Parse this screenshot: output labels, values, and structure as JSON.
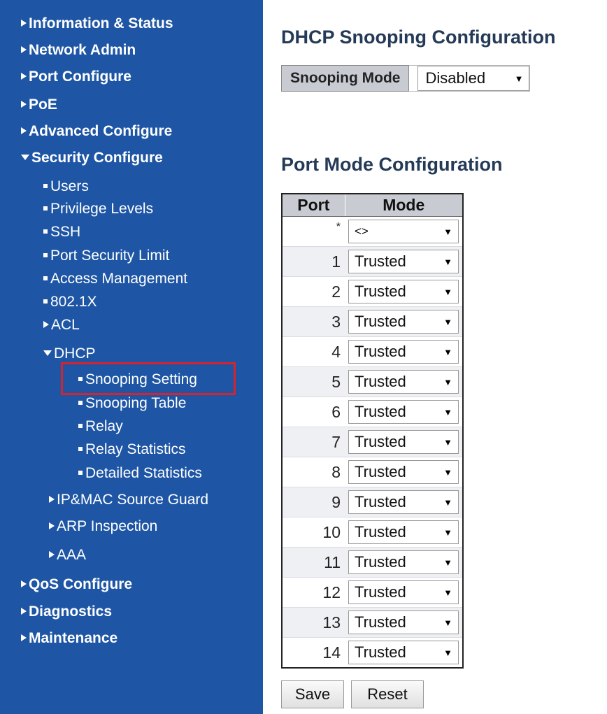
{
  "sidebar": {
    "items": [
      {
        "label": "Information & Status"
      },
      {
        "label": "Network Admin"
      },
      {
        "label": "Port Configure"
      },
      {
        "label": "PoE"
      },
      {
        "label": "Advanced Configure"
      },
      {
        "label": "Security Configure"
      },
      {
        "label": "Users"
      },
      {
        "label": "Privilege Levels"
      },
      {
        "label": "SSH"
      },
      {
        "label": "Port Security Limit"
      },
      {
        "label": "Access Management"
      },
      {
        "label": "802.1X"
      },
      {
        "label": "ACL"
      },
      {
        "label": "DHCP"
      },
      {
        "label": "Snooping Setting"
      },
      {
        "label": "Snooping Table"
      },
      {
        "label": "Relay"
      },
      {
        "label": "Relay Statistics"
      },
      {
        "label": "Detailed Statistics"
      },
      {
        "label": "IP&MAC Source Guard"
      },
      {
        "label": "ARP Inspection"
      },
      {
        "label": "AAA"
      },
      {
        "label": "QoS Configure"
      },
      {
        "label": "Diagnostics"
      },
      {
        "label": "Maintenance"
      }
    ]
  },
  "main": {
    "title": "DHCP Snooping Configuration",
    "snooping_mode_label": "Snooping Mode",
    "snooping_mode_value": "Disabled",
    "port_section_title": "Port Mode Configuration",
    "table": {
      "headers": [
        "Port",
        "Mode"
      ],
      "rows": [
        {
          "port": "*",
          "mode": "<>"
        },
        {
          "port": "1",
          "mode": "Trusted"
        },
        {
          "port": "2",
          "mode": "Trusted"
        },
        {
          "port": "3",
          "mode": "Trusted"
        },
        {
          "port": "4",
          "mode": "Trusted"
        },
        {
          "port": "5",
          "mode": "Trusted"
        },
        {
          "port": "6",
          "mode": "Trusted"
        },
        {
          "port": "7",
          "mode": "Trusted"
        },
        {
          "port": "8",
          "mode": "Trusted"
        },
        {
          "port": "9",
          "mode": "Trusted"
        },
        {
          "port": "10",
          "mode": "Trusted"
        },
        {
          "port": "11",
          "mode": "Trusted"
        },
        {
          "port": "12",
          "mode": "Trusted"
        },
        {
          "port": "13",
          "mode": "Trusted"
        },
        {
          "port": "14",
          "mode": "Trusted"
        }
      ]
    },
    "save_label": "Save",
    "reset_label": "Reset"
  },
  "colors": {
    "sidebar_bg": "#1e56a5",
    "highlight": "#d9232a",
    "heading": "#253a57"
  }
}
